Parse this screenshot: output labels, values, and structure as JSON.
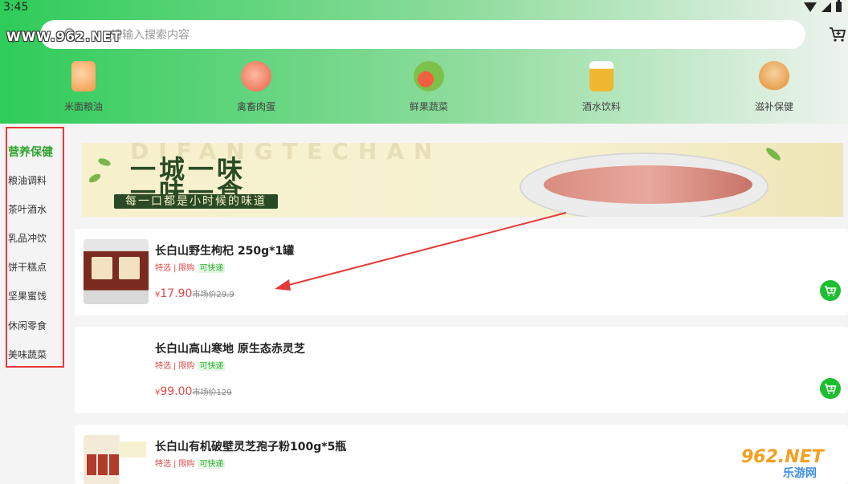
{
  "status": {
    "time": "3:45"
  },
  "watermark_top": "WWW.962.NET",
  "search": {
    "placeholder": "请输入搜索内容"
  },
  "categories": [
    {
      "label": "米面粮油",
      "icon": "rice-bag-icon",
      "color": "#f29a4a"
    },
    {
      "label": "禽畜肉蛋",
      "icon": "meat-icon",
      "color": "#f08060"
    },
    {
      "label": "鲜果蔬菜",
      "icon": "vegetables-icon",
      "color": "#7cc24a"
    },
    {
      "label": "酒水饮料",
      "icon": "beer-icon",
      "color": "#f0b830"
    },
    {
      "label": "滋补保健",
      "icon": "ginseng-icon",
      "color": "#e8a050"
    }
  ],
  "sidebar": {
    "items": [
      {
        "label": "营养保健",
        "active": true
      },
      {
        "label": "粮油调料"
      },
      {
        "label": "茶叶酒水"
      },
      {
        "label": "乳品冲饮"
      },
      {
        "label": "饼干糕点"
      },
      {
        "label": "坚果蜜饯"
      },
      {
        "label": "休闲零食"
      },
      {
        "label": "美味蔬菜"
      }
    ]
  },
  "banner": {
    "bg_text": "DIFANGTECHAN",
    "line1": "一城一味",
    "line2": "一味一食",
    "tagline": "每一口都是小时候的味道"
  },
  "products": [
    {
      "title": "长白山野生枸杞 250g*1罐",
      "tag1": "特选",
      "tag2": "限购",
      "tag3": "可快递",
      "currency": "¥",
      "price": "17.90",
      "market": "市场价29.9"
    },
    {
      "title": "长白山高山寒地 原生态赤灵芝",
      "tag1": "特选",
      "tag2": "限购",
      "tag3": "可快递",
      "currency": "¥",
      "price": "99.00",
      "market": "市场价129"
    },
    {
      "title": "长白山有机破壁灵芝孢子粉100g*5瓶",
      "tag1": "特选",
      "tag2": "限购",
      "tag3": "可快递",
      "currency": "¥",
      "price": "",
      "market": ""
    }
  ],
  "watermark_br": {
    "line1": "962.NET",
    "line2": "乐游网"
  },
  "colors": {
    "accent_green": "#1dbf2e",
    "price_red": "#e04a4a",
    "outline_red": "#e43a3a"
  }
}
